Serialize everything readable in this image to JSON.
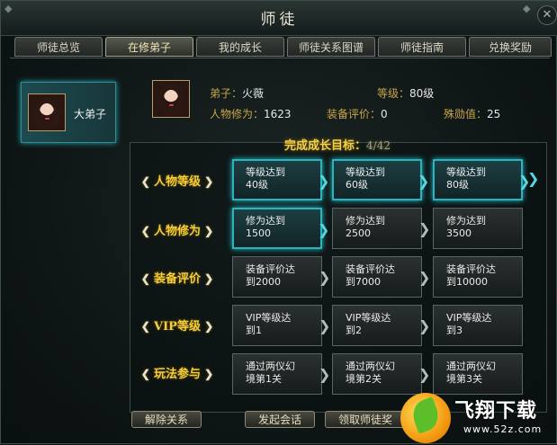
{
  "window": {
    "title": "师徒",
    "close_glyph": "✕"
  },
  "tabs": [
    {
      "label": "师徒总览",
      "active": false
    },
    {
      "label": "在修弟子",
      "active": true
    },
    {
      "label": "我的成长",
      "active": false
    },
    {
      "label": "师徒关系图谱",
      "active": false
    },
    {
      "label": "师徒指南",
      "active": false
    },
    {
      "label": "兑换奖励",
      "active": false
    }
  ],
  "disciple_list": [
    {
      "label": "大弟子",
      "selected": true
    }
  ],
  "info": {
    "name_label": "弟子：",
    "name_value": "火薇",
    "level_label": "等级：",
    "level_value": "80级",
    "cultivation_label": "人物修为：",
    "cultivation_value": "1623",
    "equip_label": "装备评价：",
    "equip_value": "0",
    "bonus_label": "殊勋值：",
    "bonus_value": "25"
  },
  "goals": {
    "title": "完成成长目标：",
    "progress": "4/42",
    "rows": [
      {
        "label": "人物等级",
        "cells": [
          {
            "text1": "等级达到",
            "text2": "40级",
            "done": true
          },
          {
            "text1": "等级达到",
            "text2": "60级",
            "done": true
          },
          {
            "text1": "等级达到",
            "text2": "80级",
            "done": true
          }
        ]
      },
      {
        "label": "人物修为",
        "cells": [
          {
            "text1": "修为达到",
            "text2": "1500",
            "done": true
          },
          {
            "text1": "修为达到",
            "text2": "2500",
            "done": false
          },
          {
            "text1": "修为达到",
            "text2": "3500",
            "done": false
          }
        ]
      },
      {
        "label": "装备评价",
        "cells": [
          {
            "text1": "装备评价达",
            "text2": "到2000",
            "done": false
          },
          {
            "text1": "装备评价达",
            "text2": "到7000",
            "done": false
          },
          {
            "text1": "装备评价达",
            "text2": "到10000",
            "done": false
          }
        ]
      },
      {
        "label": "VIP等级",
        "cells": [
          {
            "text1": "VIP等级达",
            "text2": "到1",
            "done": false
          },
          {
            "text1": "VIP等级达",
            "text2": "到2",
            "done": false
          },
          {
            "text1": "VIP等级达",
            "text2": "到3",
            "done": false
          }
        ]
      },
      {
        "label": "玩法参与",
        "cells": [
          {
            "text1": "通过两仪幻",
            "text2": "境第1关",
            "done": false
          },
          {
            "text1": "通过两仪幻",
            "text2": "境第2关",
            "done": false
          },
          {
            "text1": "通过两仪幻",
            "text2": "境第3关",
            "done": false
          }
        ]
      }
    ]
  },
  "buttons": {
    "dismiss": "解除关系",
    "chat": "发起会话",
    "claim": "领取师徒奖"
  },
  "watermark": {
    "title": "飞翔下载",
    "url": "www.52z.com"
  },
  "colors": {
    "accent_cyan": "#2bb3bf",
    "label_gold": "#f4cf3a"
  }
}
